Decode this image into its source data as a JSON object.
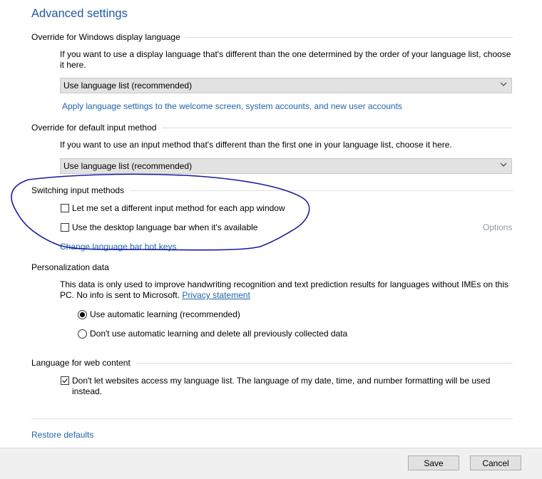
{
  "page": {
    "title": "Advanced settings"
  },
  "display_language": {
    "heading": "Override for Windows display language",
    "description": "If you want to use a display language that's different than the one determined by the order of your language list, choose it here.",
    "dropdown_value": "Use language list (recommended)",
    "apply_link": "Apply language settings to the welcome screen, system accounts, and new user accounts"
  },
  "input_method": {
    "heading": "Override for default input method",
    "description": "If you want to use an input method that's different than the first one in your language list, choose it here.",
    "dropdown_value": "Use language list (recommended)"
  },
  "switching": {
    "heading": "Switching input methods",
    "option_per_app": {
      "label": "Let me set a different input method for each app window",
      "checked": false
    },
    "option_desktop_bar": {
      "label": "Use the desktop language bar when it's available",
      "checked": false
    },
    "options_link": "Options",
    "hotkeys_link": "Change language bar hot keys"
  },
  "personalization": {
    "heading": "Personalization data",
    "description": "This data is only used to improve handwriting recognition and text prediction results for languages without IMEs on this PC. No info is sent to Microsoft.",
    "privacy_link": "Privacy statement",
    "radio_auto": {
      "label": "Use automatic learning (recommended)",
      "selected": true
    },
    "radio_no_auto": {
      "label": "Don't use automatic learning and delete all previously collected data",
      "selected": false
    }
  },
  "web_content": {
    "heading": "Language for web content",
    "option_block": {
      "label": "Don't let websites access my language list. The language of my date, time, and number formatting will be used instead.",
      "checked": true
    }
  },
  "restore_defaults": "Restore defaults",
  "footer": {
    "save_label": "Save",
    "cancel_label": "Cancel"
  },
  "icons": {
    "dropdown": "chevron-down-icon",
    "checkbox_checked": "checkmark-icon",
    "radio_selected": "radio-dot-icon"
  },
  "colors": {
    "title": "#1e5aa8",
    "link": "#1f64ad",
    "options_disabled": "#8a9aa8",
    "annotation": "#1a1aa0",
    "dropdown_bg": "#e2e2e2",
    "footer_bg": "#f0f0f0"
  }
}
